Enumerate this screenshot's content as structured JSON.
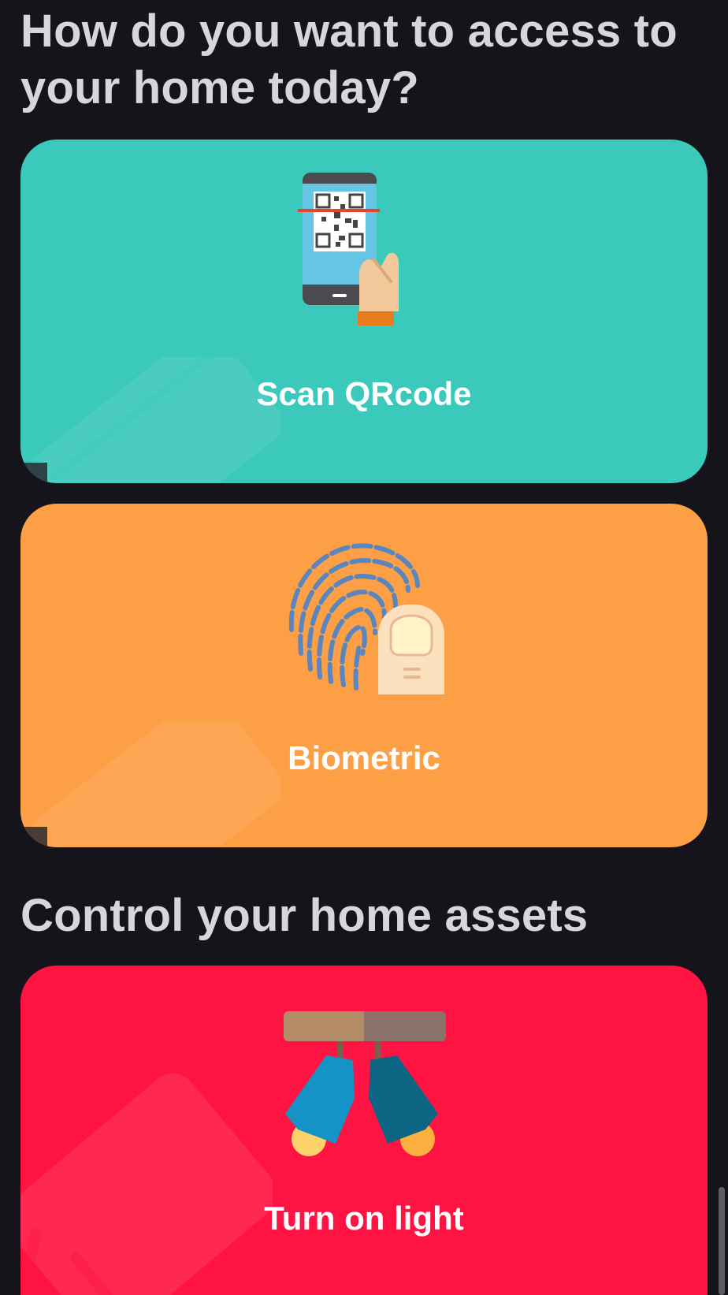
{
  "access_section": {
    "title": "How do you want to access to your home today?"
  },
  "cards": {
    "qr": {
      "label": "Scan QRcode",
      "icon": "qr-scan-phone-icon",
      "color": "#3bc9bb"
    },
    "biometric": {
      "label": "Biometric",
      "icon": "fingerprint-icon",
      "color": "#fd9f45"
    },
    "light": {
      "label": "Turn on light",
      "icon": "spotlight-icon",
      "color": "#fe1343"
    }
  },
  "control_section": {
    "title": "Control your home assets"
  }
}
